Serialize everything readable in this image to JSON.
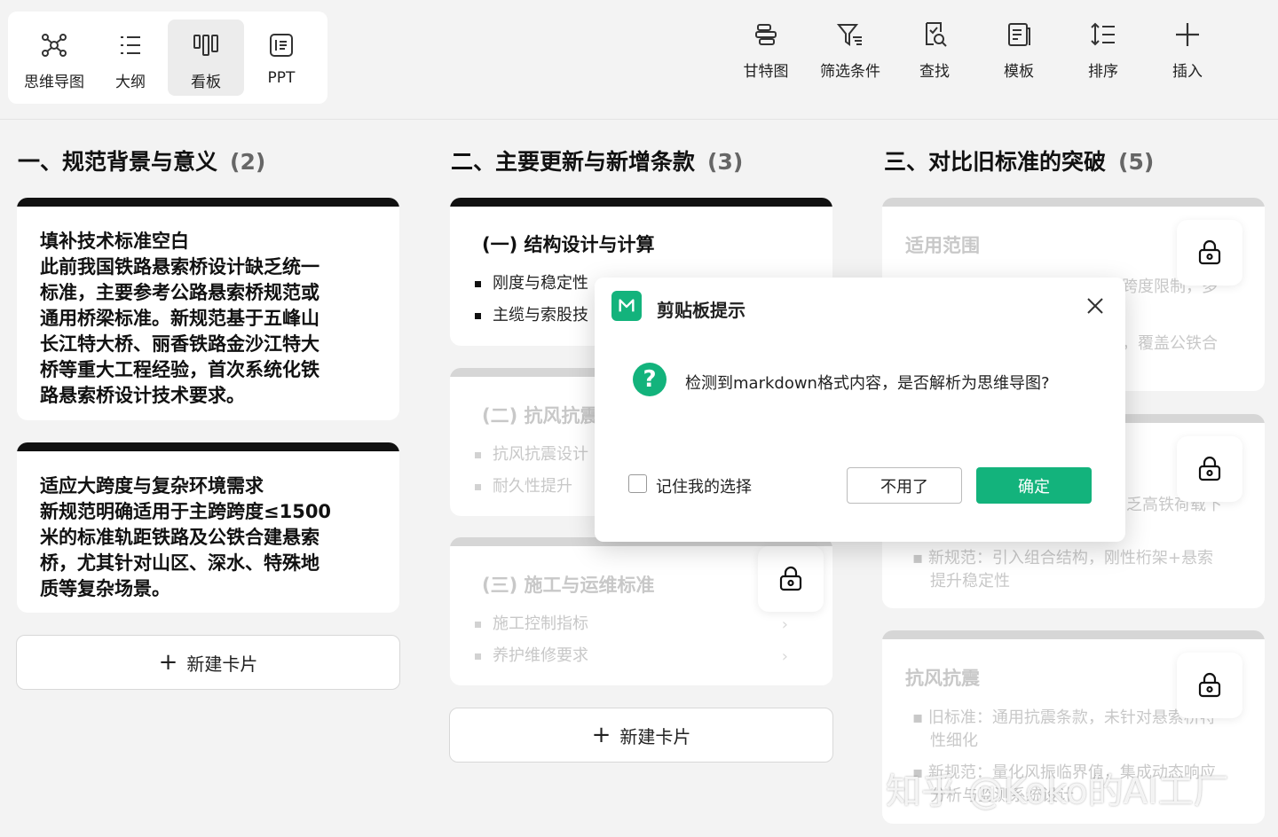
{
  "views": [
    {
      "label": "思维导图",
      "icon": "mindmap-icon"
    },
    {
      "label": "大纲",
      "icon": "outline-icon"
    },
    {
      "label": "看板",
      "icon": "kanban-icon",
      "active": true
    },
    {
      "label": "PPT",
      "icon": "ppt-icon"
    }
  ],
  "tools": [
    {
      "label": "甘特图",
      "icon": "gantt-icon"
    },
    {
      "label": "筛选条件",
      "icon": "filter-icon"
    },
    {
      "label": "查找",
      "icon": "find-icon"
    },
    {
      "label": "模板",
      "icon": "template-icon"
    },
    {
      "label": "排序",
      "icon": "sort-icon"
    },
    {
      "label": "插入",
      "icon": "plus-icon"
    }
  ],
  "columns": [
    {
      "title": "一、规范背景与意义",
      "count": "(2)",
      "cards": [
        {
          "lines": [
            "填补技术标准空白",
            "此前我国铁路悬索桥设计缺乏统一",
            "标准，主要参考公路悬索桥规范或",
            "通用桥梁标准。新规范基于五峰山",
            "长江特大桥、丽香铁路金沙江特大",
            "桥等重大工程经验，首次系统化铁",
            "路悬索桥设计技术要求。"
          ]
        },
        {
          "lines": [
            "适应大跨度与复杂环境需求",
            "新规范明确适用于主跨跨度≤1500",
            "米的标准轨距铁路及公铁合建悬索",
            "桥，尤其针对山区、深水、特殊地",
            "质等复杂场景。"
          ]
        }
      ],
      "new_card": "新建卡片"
    },
    {
      "title": "二、主要更新与新增条款",
      "count": "(3)",
      "cards": [
        {
          "title": "(一) 结构设计与计算",
          "items": [
            "刚度与稳定性",
            "主缆与索股技"
          ]
        },
        {
          "title": "(二) 抗风抗震",
          "items": [
            "抗风抗震设计",
            "耐久性提升"
          ]
        },
        {
          "title": "(三) 施工与运维标准",
          "items": [
            "施工控制指标",
            "养护维修要求"
          ]
        }
      ],
      "new_card": "新建卡片"
    },
    {
      "title": "三、对比旧标准的突破",
      "count": "(5)",
      "cards": [
        {
          "title": "适用范围",
          "lines": [
            "跨度限制，多",
            "，覆盖公铁合"
          ]
        },
        {
          "lines": [
            "乏高铁荷载下",
            "新规范：引入组合结构，刚性桁架+悬索",
            "提升稳定性"
          ]
        },
        {
          "title": "抗风抗震",
          "lines": [
            "旧标准：通用抗震条款，未针对悬索桥特",
            "性细化",
            "新规范：量化风振临界值，集成动态响应",
            "分析与监测系统设计"
          ]
        }
      ]
    }
  ],
  "dialog": {
    "title": "剪贴板提示",
    "message": "检测到markdown格式内容，是否解析为思维导图?",
    "remember": "记住我的选择",
    "cancel": "不用了",
    "ok": "确定"
  },
  "watermark": "知乎 @Koko的AI工厂",
  "colors": {
    "accent": "#13b37c",
    "card_bar": "#111111"
  }
}
